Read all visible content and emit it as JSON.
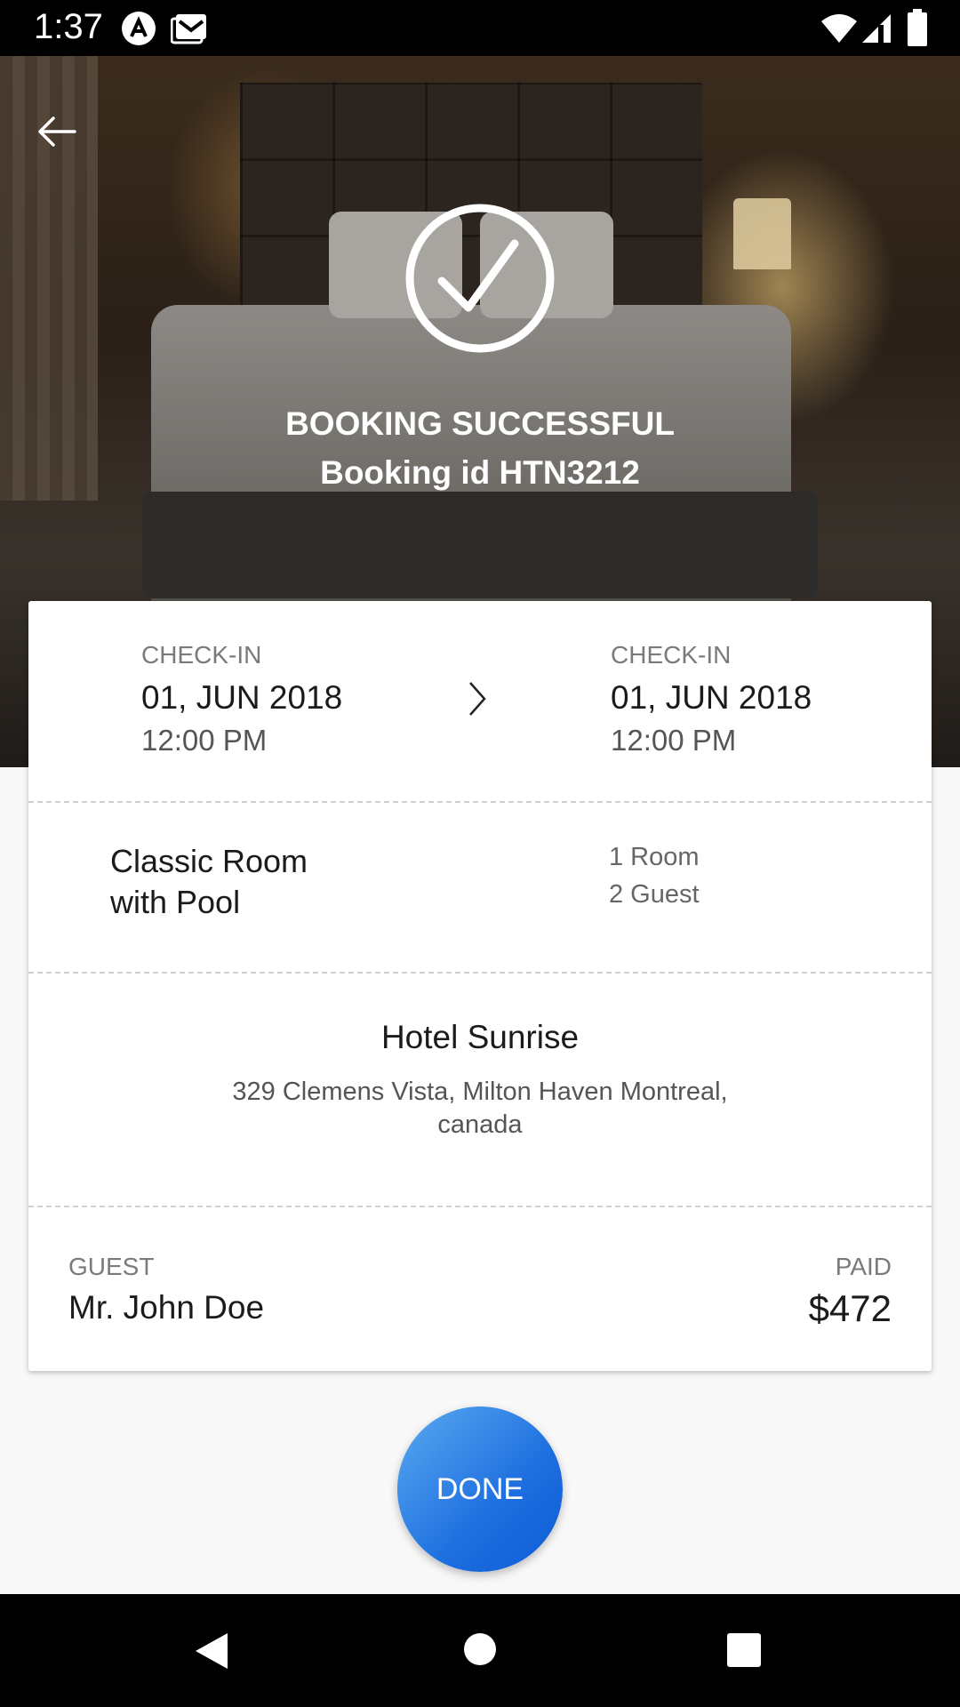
{
  "status_bar": {
    "time": "1:37"
  },
  "header": {
    "title": "BOOKING SUCCESSFUL",
    "booking_line": "Booking id  HTN3212"
  },
  "stay": {
    "checkin_label": "CHECK-IN",
    "checkin_date": "01, JUN 2018",
    "checkin_time": "12:00 PM",
    "checkout_label": "CHECK-IN",
    "checkout_date": "01, JUN 2018",
    "checkout_time": "12:00 PM"
  },
  "room": {
    "name_line1": "Classic Room",
    "name_line2": "with Pool",
    "rooms": "1 Room",
    "guests": "2 Guest"
  },
  "hotel": {
    "name": "Hotel Sunrise",
    "address_line1": "329 Clemens Vista, Milton Haven Montreal,",
    "address_line2": "canada"
  },
  "billing": {
    "guest_label": "GUEST",
    "guest_name": "Mr. John Doe",
    "paid_label": "PAID",
    "paid_amount": "$472"
  },
  "actions": {
    "done_label": "DONE"
  },
  "colors": {
    "accent": "#1e6fe0",
    "accent_light": "#5aaaf0"
  },
  "icons": [
    "back-arrow-icon",
    "check-circle-icon",
    "chevron-right-icon",
    "wifi-icon",
    "signal-icon",
    "battery-icon",
    "back-triangle-icon",
    "home-circle-icon",
    "recents-square-icon"
  ]
}
